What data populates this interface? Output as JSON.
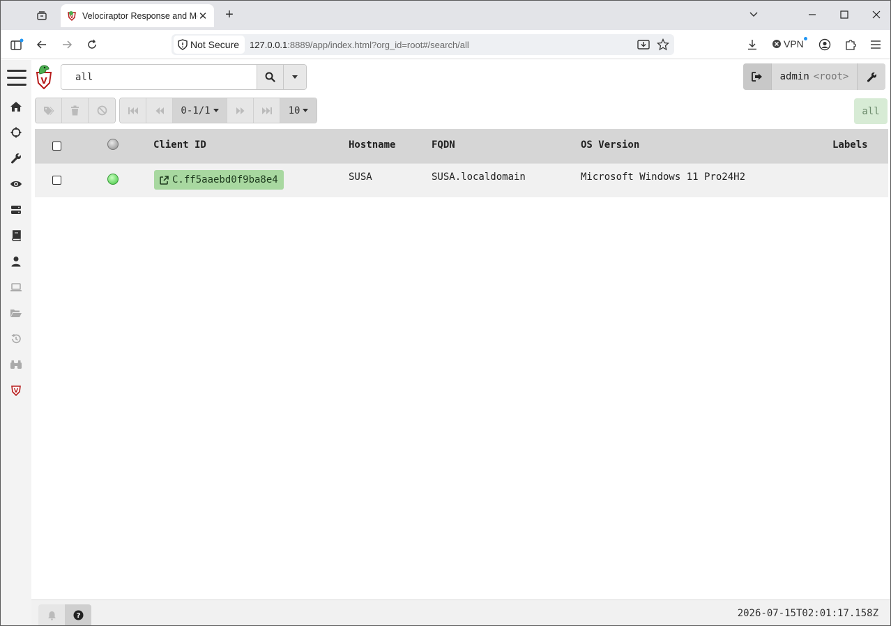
{
  "browser": {
    "tab_title": "Velociraptor Response and Monitoring",
    "address": {
      "security_label": "Not Secure",
      "url_host": "127.0.0.1",
      "url_rest": ":8889/app/index.html?org_id=root#/search/all"
    },
    "vpn_label": "VPN"
  },
  "app": {
    "search": {
      "query": "all"
    },
    "user": {
      "name": "admin",
      "org": "<root>"
    },
    "pagination": {
      "range_label": "0-1/1",
      "page_size": "10"
    },
    "filter_badge": "all",
    "table": {
      "columns": [
        "Client ID",
        "Hostname",
        "FQDN",
        "OS Version",
        "Labels"
      ],
      "rows": [
        {
          "status": "online",
          "client_id": "C.ff5aaebd0f9ba8e4",
          "hostname": "SUSA",
          "fqdn": "SUSA.localdomain",
          "os_version": "Microsoft Windows 11 Pro24H2",
          "labels": ""
        }
      ]
    },
    "footer": {
      "timestamp": "2026-07-15T02:01:17.158Z"
    }
  },
  "colors": {
    "client_id_bg": "#a8d8a0",
    "online_dot": "#3ec43e",
    "filter_badge_bg": "#d7ebd5",
    "header_bg": "#d6d6d6"
  },
  "icons": {
    "sidebar": [
      "home-icon",
      "crosshairs-icon",
      "wrench-icon",
      "eye-icon",
      "server-icon",
      "book-icon",
      "user-icon",
      "laptop-icon",
      "folder-open-icon",
      "history-icon",
      "binoculars-icon",
      "velociraptor-shield-icon"
    ]
  }
}
